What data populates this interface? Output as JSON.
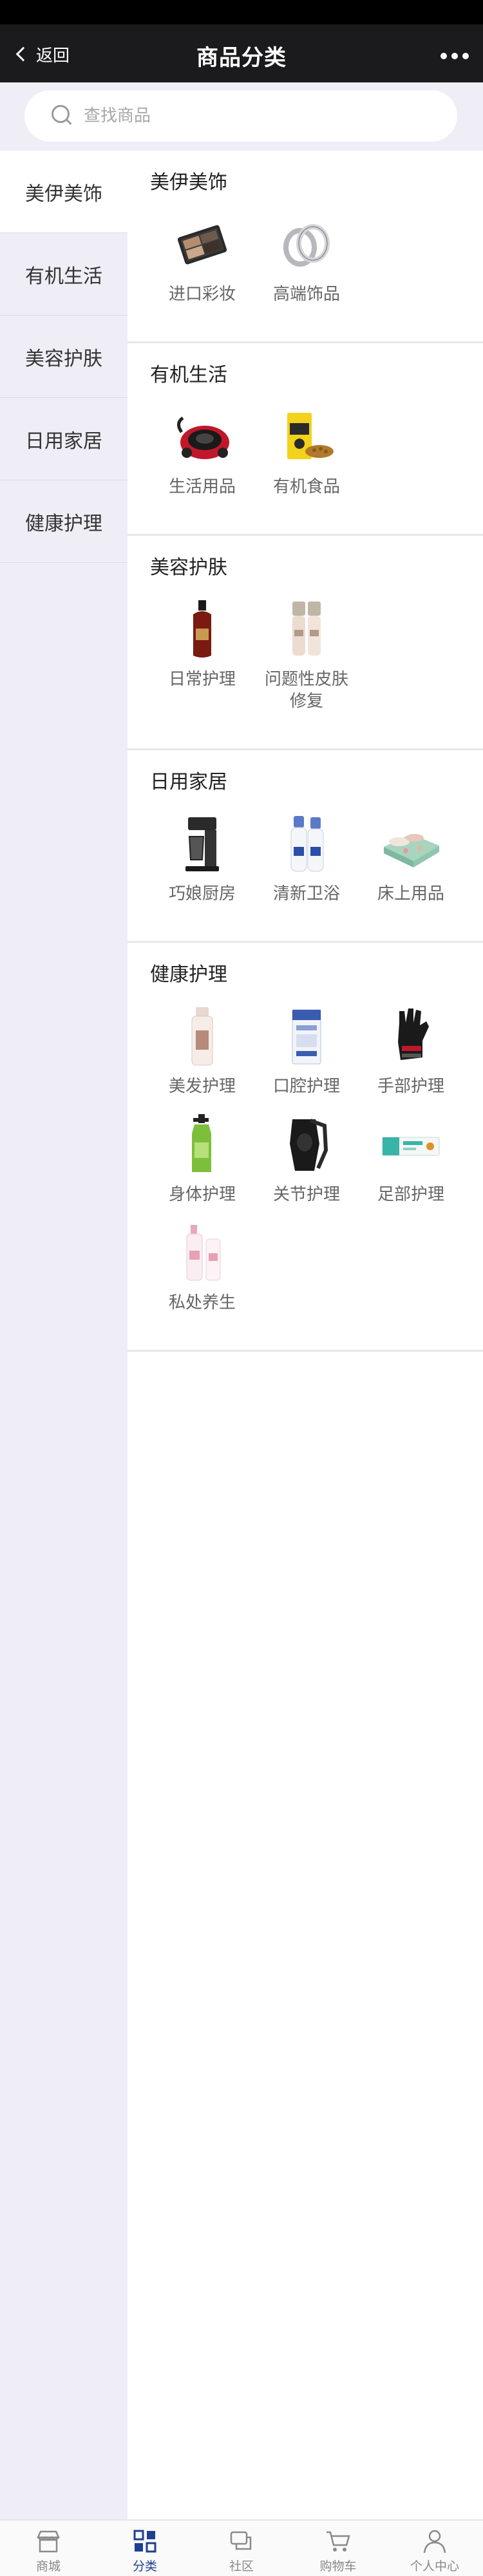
{
  "header": {
    "back_label": "返回",
    "title": "商品分类"
  },
  "search": {
    "placeholder": "查找商品"
  },
  "sidebar": {
    "items": [
      {
        "label": "美伊美饰",
        "active": true
      },
      {
        "label": "有机生活",
        "active": false
      },
      {
        "label": "美容护肤",
        "active": false
      },
      {
        "label": "日用家居",
        "active": false
      },
      {
        "label": "健康护理",
        "active": false
      }
    ]
  },
  "sections": [
    {
      "title": "美伊美饰",
      "items": [
        {
          "label": "进口彩妆",
          "icon": "eyeshadow-palette-icon"
        },
        {
          "label": "高端饰品",
          "icon": "rings-icon"
        }
      ]
    },
    {
      "title": "有机生活",
      "items": [
        {
          "label": "生活用品",
          "icon": "vacuum-cleaner-icon"
        },
        {
          "label": "有机食品",
          "icon": "organic-food-icon"
        }
      ]
    },
    {
      "title": "美容护肤",
      "items": [
        {
          "label": "日常护理",
          "line2": "",
          "icon": "serum-bottle-icon"
        },
        {
          "label": "问题性皮肤",
          "line2": "修复",
          "icon": "skincare-bottles-icon"
        }
      ]
    },
    {
      "title": "日用家居",
      "items": [
        {
          "label": "巧娘厨房",
          "icon": "coffee-maker-icon"
        },
        {
          "label": "清新卫浴",
          "icon": "spray-bottles-icon"
        },
        {
          "label": "床上用品",
          "icon": "bedding-icon"
        }
      ]
    },
    {
      "title": "健康护理",
      "items": [
        {
          "label": "美发护理",
          "icon": "hair-care-bottle-icon"
        },
        {
          "label": "口腔护理",
          "icon": "toothpaste-icon"
        },
        {
          "label": "手部护理",
          "icon": "glove-icon"
        },
        {
          "label": "身体护理",
          "icon": "body-wash-icon"
        },
        {
          "label": "关节护理",
          "icon": "knee-brace-icon"
        },
        {
          "label": "足部护理",
          "icon": "foot-care-box-icon"
        },
        {
          "label": "私处养生",
          "icon": "intimate-care-bottle-icon"
        }
      ]
    }
  ],
  "tabbar": {
    "items": [
      {
        "label": "商城",
        "icon": "shop-icon",
        "active": false
      },
      {
        "label": "分类",
        "icon": "category-grid-icon",
        "active": true
      },
      {
        "label": "社区",
        "icon": "community-chat-icon",
        "active": false
      },
      {
        "label": "购物车",
        "icon": "cart-icon",
        "active": false
      },
      {
        "label": "个人中心",
        "icon": "user-icon",
        "active": false
      }
    ]
  },
  "colors": {
    "nav_bg": "#1b1b1d",
    "sidebar_bg": "#efeef6",
    "tab_active": "#1f3f8f"
  }
}
